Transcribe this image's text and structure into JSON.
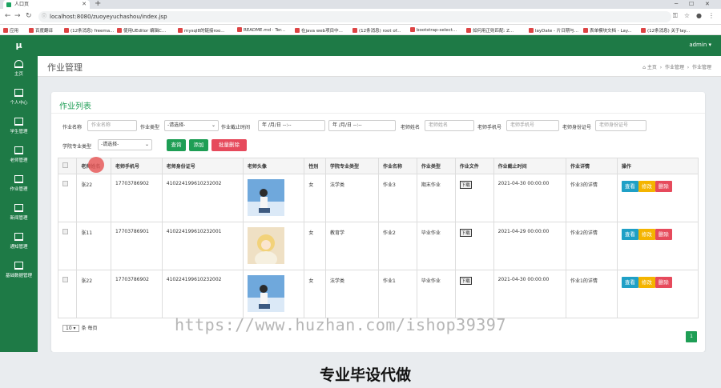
{
  "browser": {
    "tab_title": "人口页",
    "url": "localhost:8080/zuoyeyuchashou/index.jsp",
    "bookmarks": [
      "应用",
      "百度翻译",
      "(12条消息) freema...",
      "使用UEditor 编辑C...",
      "mysql8的链接roo...",
      "README.md · Ter...",
      "在java web项目中...",
      "(12条消息) root of...",
      "bootstrap-select...",
      "如何用正则匹配: Z...",
      "layDate - 片日期与...",
      "表单模块文档 - Lay...",
      "(12条消息) 关于lay..."
    ]
  },
  "sidebar": {
    "logo": "μ",
    "items": [
      {
        "label": "主页",
        "icon": "dashboard-icon"
      },
      {
        "label": "个人中心",
        "icon": "monitor-icon"
      },
      {
        "label": "学生管理",
        "icon": "monitor-icon"
      },
      {
        "label": "老师管理",
        "icon": "monitor-icon"
      },
      {
        "label": "作业管理",
        "icon": "monitor-icon"
      },
      {
        "label": "新闻管理",
        "icon": "monitor-icon"
      },
      {
        "label": "通知管理",
        "icon": "monitor-icon"
      },
      {
        "label": "基础数据管理",
        "icon": "monitor-icon"
      }
    ]
  },
  "header": {
    "user": "admin ▾"
  },
  "page": {
    "title": "作业管理",
    "breadcrumb": [
      "主页",
      "作业管理",
      "作业管理"
    ]
  },
  "card": {
    "title": "作业列表",
    "filters": {
      "name_label": "作业名称",
      "name_placeholder": "作业名称",
      "type_label": "作业类型",
      "type_value": "-请选择-",
      "deadline_label": "作业截止时间",
      "date_from": "年 /月/日 --:--",
      "date_to": "年 /月/日 --:--",
      "teacher_label": "老师姓名",
      "teacher_placeholder": "老师姓名",
      "phone_label": "老师手机号",
      "phone_placeholder": "老师手机号",
      "idcard_label": "老师身份证号",
      "idcard_placeholder": "老师身份证号",
      "major_label": "学院专业类型",
      "major_value": "-请选择-"
    },
    "buttons": {
      "query": "查询",
      "add": "添加",
      "batch_delete": "批量删除"
    },
    "columns": [
      "",
      "老师姓名",
      "老师手机号",
      "老师身份证号",
      "老师头像",
      "性别",
      "学院专业类型",
      "作业名称",
      "作业类型",
      "作业文件",
      "作业截止时间",
      "作业详情",
      "操作"
    ],
    "rows": [
      {
        "teacher": "张22",
        "phone": "17703786902",
        "idcard": "410224199610232002",
        "gender": "女",
        "major": "法学类",
        "hw_name": "作业3",
        "hw_type": "期末作业",
        "file": "下载",
        "deadline": "2021-04-30 00:00:00",
        "detail": "作业3的详情"
      },
      {
        "teacher": "张11",
        "phone": "17703786901",
        "idcard": "410224199610232001",
        "gender": "女",
        "major": "教育学",
        "hw_name": "作业2",
        "hw_type": "毕业作业",
        "file": "下载",
        "deadline": "2021-04-29 00:00:00",
        "detail": "作业2的详情"
      },
      {
        "teacher": "张22",
        "phone": "17703786902",
        "idcard": "410224199610232002",
        "gender": "女",
        "major": "法学类",
        "hw_name": "作业1",
        "hw_type": "毕业作业",
        "file": "下载",
        "deadline": "2021-04-30 00:00:00",
        "detail": "作业1的详情"
      }
    ],
    "actions": {
      "view": "查看",
      "edit": "修改",
      "delete": "删除"
    },
    "page_size": "10 ▾",
    "page_size_suffix": "条 每页",
    "current_page": "1"
  },
  "overlay": {
    "watermark": "https://www.huzhan.com/ishop39397",
    "banner": "专业毕设代做"
  },
  "colors": {
    "green": "#1e7a46",
    "query_btn": "#1e9e55",
    "delete_btn": "#e64a5c",
    "view_btn": "#1fa0c6",
    "edit_btn": "#f4b400"
  }
}
